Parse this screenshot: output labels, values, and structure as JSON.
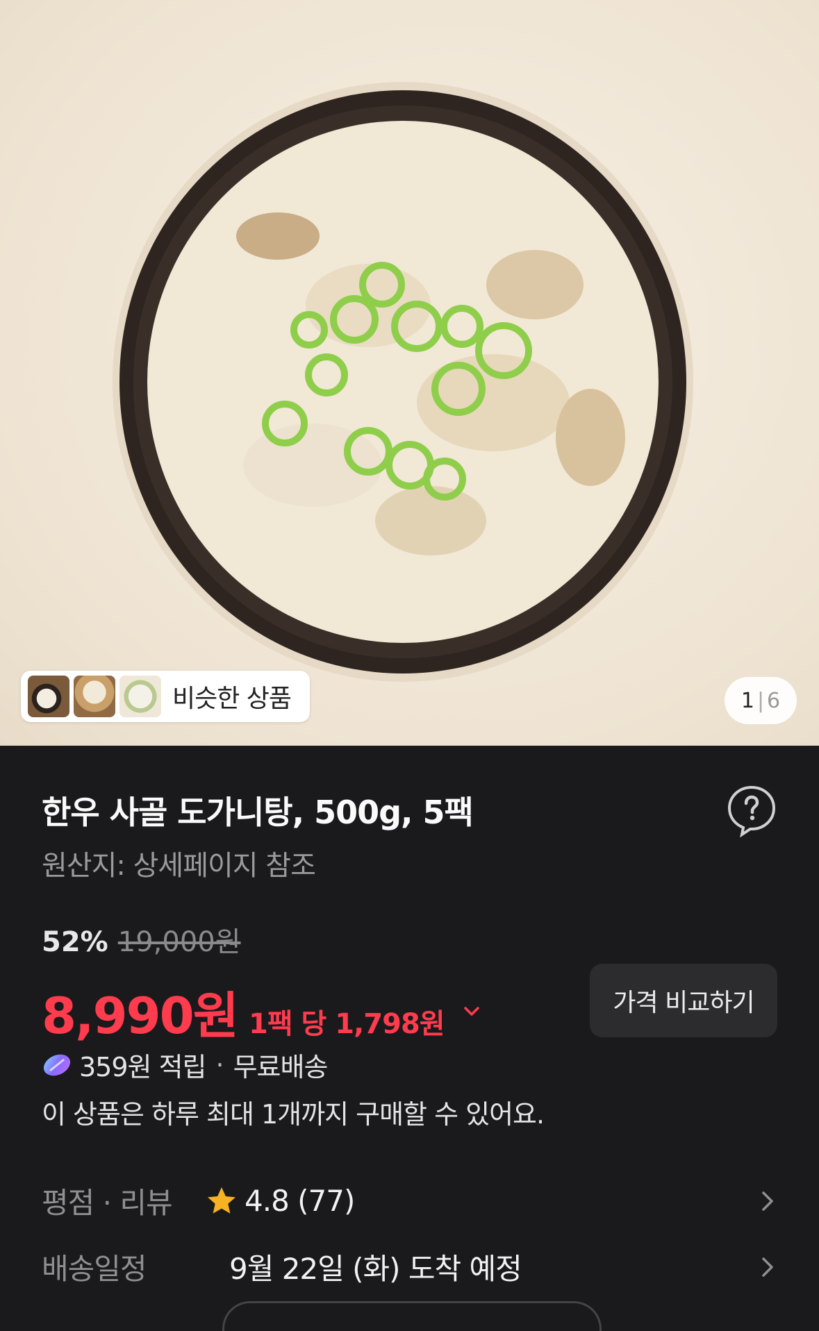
{
  "gallery": {
    "similar_label": "비슷한 상품",
    "page_current": "1",
    "page_separator": "|",
    "page_total": "6"
  },
  "product": {
    "title": "한우 사골 도가니탕, 500g, 5팩",
    "origin": "원산지: 상세페이지 참조",
    "discount": "52%",
    "original_price": "19,000원",
    "price": "8,990원",
    "unit_price": "1팩 당 1,798원",
    "compare_label": "가격 비교하기",
    "points": "359원 적립",
    "shipping": "무료배송",
    "benefit_separator": "·",
    "purchase_limit": "이 상품은 하루 최대 1개까지 구매할 수 있어요."
  },
  "rating": {
    "label": "평점 · 리뷰",
    "value": "4.8 (77)"
  },
  "delivery": {
    "label": "배송일정",
    "value": "9월 22일 (화) 도착 예정"
  },
  "colors": {
    "price": "#ff3b4e",
    "background": "#1a1a1c",
    "star": "#f5b323"
  }
}
